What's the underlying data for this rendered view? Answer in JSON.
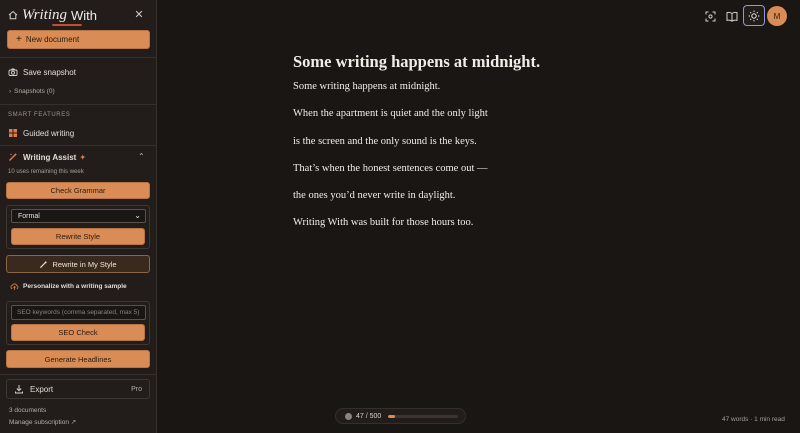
{
  "app": {
    "brand_part1": "Writing",
    "brand_part2": "With"
  },
  "sidebar": {
    "new_document": "New document",
    "save_snapshot": "Save snapshot",
    "snapshots": "Snapshots (0)",
    "section_smart": "SMART FEATURES",
    "guided_writing": "Guided writing",
    "assist_title": "Writing Assist",
    "assist_sparkle": "✦",
    "uses_remaining": "10 uses remaining this week",
    "check_grammar": "Check Grammar",
    "style_selected": "Formal",
    "rewrite_style": "Rewrite Style",
    "rewrite_my_style": "Rewrite in My Style",
    "personalize": "Personalize with a writing sample",
    "seo_placeholder": "SEO keywords (comma separated, max 5)",
    "seo_value": "",
    "seo_check": "SEO Check",
    "generate_headlines": "Generate Headlines",
    "export": "Export",
    "export_badge": "Pro",
    "documents_count": "3 documents",
    "manage_subscription": "Manage subscription ↗"
  },
  "header": {
    "avatar_initial": "M"
  },
  "editor": {
    "title": "Some writing happens at midnight.",
    "lines": [
      "Some writing happens at midnight.",
      "When the apartment is quiet and the only light",
      "is the screen and the only sound is the keys.",
      "That’s when the honest sentences come out —",
      "the ones you’d never write in daylight.",
      "Writing With was built for those hours too."
    ]
  },
  "footer": {
    "progress_label": "47 / 500",
    "progress_value": 47,
    "progress_goal": 500,
    "word_stats": "47 words · 1 min read"
  },
  "colors": {
    "accent": "#d98c55",
    "background": "#1a1614",
    "sidebar": "#221d1a",
    "theme_ring": "#8f9ad8"
  }
}
